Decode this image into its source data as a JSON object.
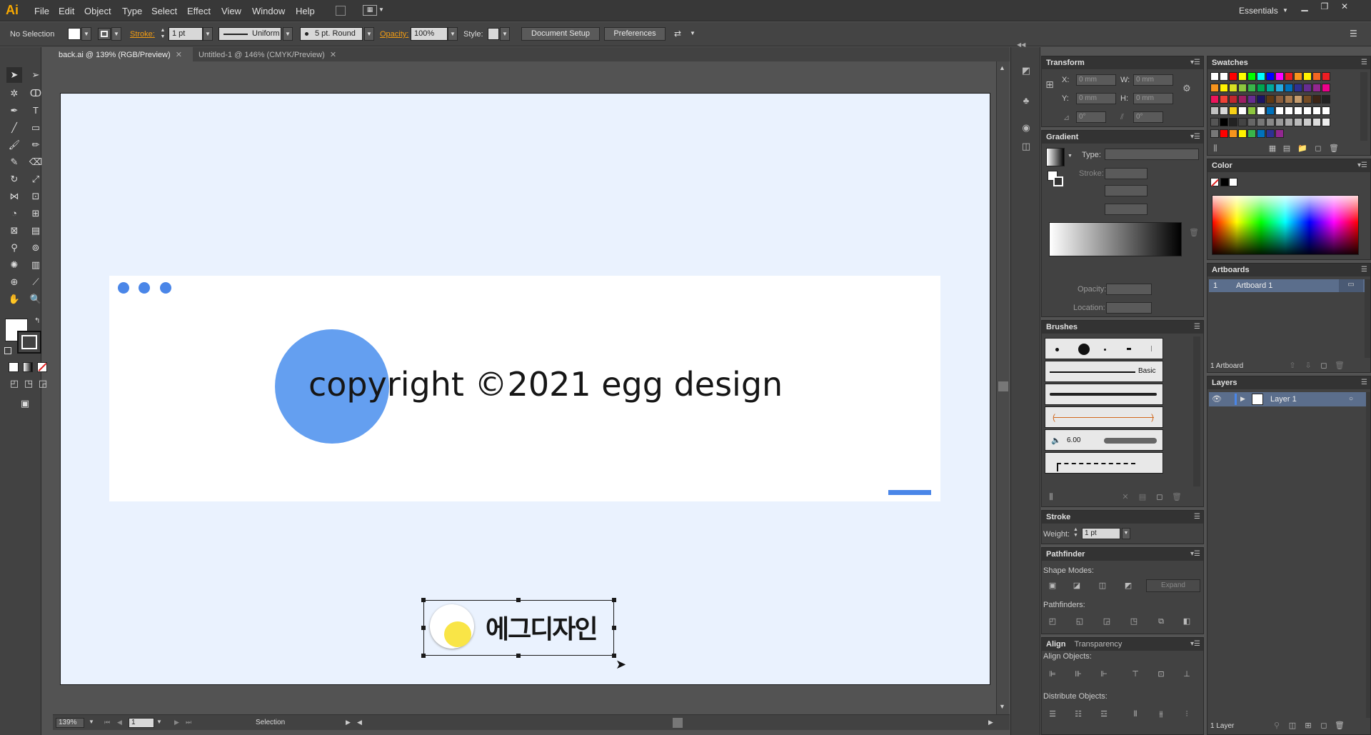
{
  "app": {
    "logo": "Ai",
    "menu": [
      "File",
      "Edit",
      "Object",
      "Type",
      "Select",
      "Effect",
      "View",
      "Window",
      "Help"
    ],
    "workspace": "Essentials"
  },
  "control_bar": {
    "selection": "No Selection",
    "stroke_label": "Stroke:",
    "stroke_weight": "1 pt",
    "stroke_profile": "Uniform",
    "brush": "5 pt. Round",
    "opacity_label": "Opacity:",
    "opacity": "100%",
    "style_label": "Style:",
    "document_setup": "Document Setup",
    "preferences": "Preferences"
  },
  "tabs": [
    {
      "label": "back.ai @ 139% (RGB/Preview)",
      "active": true
    },
    {
      "label": "Untitled-1 @ 146% (CMYK/Preview)",
      "active": false
    }
  ],
  "artwork": {
    "copyright": "copyright ©2021 egg design",
    "logo_text": "에그디자인",
    "colors": {
      "artboard": "#eaf2fe",
      "blue": "#4a86e8",
      "circle": "#649ff0",
      "yolk": "#f9e547"
    }
  },
  "panels": {
    "transform": {
      "title": "Transform",
      "x_label": "X:",
      "x": "0 mm",
      "y_label": "Y:",
      "y": "0 mm",
      "w_label": "W:",
      "w": "0 mm",
      "h_label": "H:",
      "h": "0 mm",
      "rot": "0°",
      "shear": "0°"
    },
    "gradient": {
      "title": "Gradient",
      "type_label": "Type:",
      "stroke_label": "Stroke:",
      "opacity_label": "Opacity:",
      "location_label": "Location:"
    },
    "brushes": {
      "title": "Brushes",
      "basic": "Basic",
      "size": "6.00"
    },
    "stroke": {
      "title": "Stroke",
      "weight_label": "Weight:",
      "weight": "1 pt"
    },
    "pathfinder": {
      "title": "Pathfinder",
      "shape_modes": "Shape Modes:",
      "expand": "Expand",
      "pathfinders": "Pathfinders:"
    },
    "align": {
      "title": "Align",
      "tab2": "Transparency",
      "align_objects": "Align Objects:",
      "distribute_objects": "Distribute Objects:"
    },
    "swatches": {
      "title": "Swatches"
    },
    "color": {
      "title": "Color"
    },
    "artboards": {
      "title": "Artboards",
      "rows": [
        {
          "num": "1",
          "name": "Artboard 1"
        }
      ],
      "count": "1 Artboard"
    },
    "layers": {
      "title": "Layers",
      "rows": [
        {
          "name": "Layer 1"
        }
      ],
      "count": "1 Layer"
    }
  },
  "status": {
    "zoom": "139%",
    "page": "1",
    "tool": "Selection"
  }
}
